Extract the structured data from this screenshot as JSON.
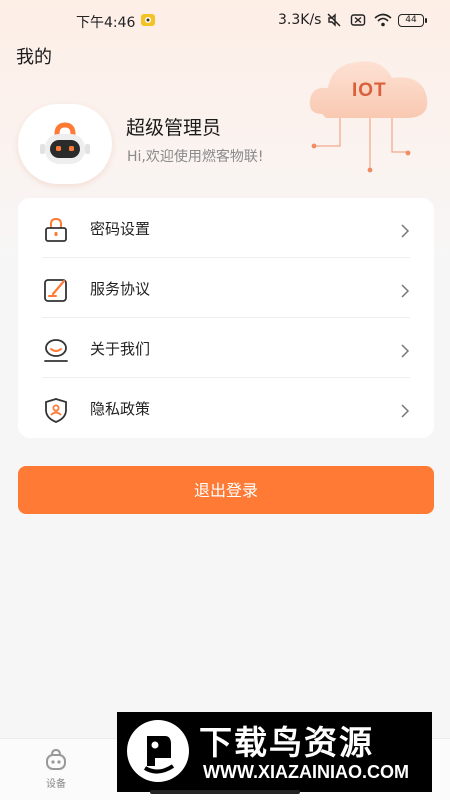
{
  "status_bar": {
    "time": "下午4:46",
    "network_speed": "3.3K/s",
    "battery": "44"
  },
  "page": {
    "title": "我的"
  },
  "iot_badge": {
    "text": "IOT"
  },
  "profile": {
    "name": "超级管理员",
    "greeting": "Hi,欢迎使用燃客物联!"
  },
  "menu": {
    "items": [
      {
        "label": "密码设置",
        "icon": "lock-icon"
      },
      {
        "label": "服务协议",
        "icon": "document-edit-icon"
      },
      {
        "label": "关于我们",
        "icon": "info-face-icon"
      },
      {
        "label": "隐私政策",
        "icon": "shield-icon"
      }
    ]
  },
  "logout": {
    "label": "退出登录"
  },
  "tab_bar": {
    "devices_label": "设备"
  },
  "watermark": {
    "title": "下载鸟资源",
    "url": "WWW.XIAZAINIAO.COM"
  },
  "colors": {
    "accent": "#ff7a35",
    "icon_accent": "#ff7a35"
  }
}
